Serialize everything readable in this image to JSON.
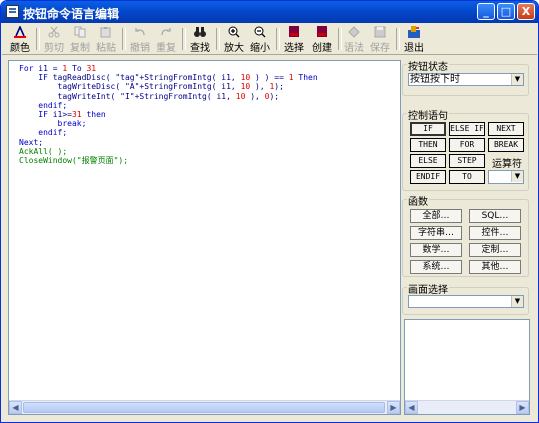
{
  "window": {
    "title": "按钮命令语言编辑",
    "minimize": "_",
    "maximize": "□",
    "close": "X"
  },
  "toolbar": {
    "color": "颜色",
    "cut": "剪切",
    "copy": "复制",
    "paste": "粘贴",
    "undo": "撤销",
    "redo": "重复",
    "find": "查找",
    "zoom_in": "放大",
    "zoom_out": "缩小",
    "select": "选择",
    "create": "创建",
    "syntax": "语法",
    "save": "保存",
    "exit": "退出"
  },
  "editor": {
    "lines": [
      [
        {
          "t": "For ",
          "c": "kw"
        },
        {
          "t": "i1 = ",
          "c": ""
        },
        {
          "t": "1",
          "c": "num"
        },
        {
          "t": " To ",
          "c": "kw"
        },
        {
          "t": "31",
          "c": "num"
        }
      ],
      [
        {
          "t": "    IF ",
          "c": "kw"
        },
        {
          "t": "tagReadDisc( \"tag\"+StringFromIntg( i1, ",
          "c": ""
        },
        {
          "t": "10",
          "c": "num"
        },
        {
          "t": " ) ) == ",
          "c": ""
        },
        {
          "t": "1",
          "c": "num"
        },
        {
          "t": " Then",
          "c": "kw"
        }
      ],
      [
        {
          "t": "        tagWriteDisc( \"A\"+StringFromIntg( i1, ",
          "c": ""
        },
        {
          "t": "10",
          "c": "num"
        },
        {
          "t": " ), ",
          "c": ""
        },
        {
          "t": "1",
          "c": "num"
        },
        {
          "t": ");",
          "c": ""
        }
      ],
      [
        {
          "t": "        tagWriteInt( \"I\"+StringFromIntg( i1, ",
          "c": ""
        },
        {
          "t": "10",
          "c": "num"
        },
        {
          "t": " ), ",
          "c": ""
        },
        {
          "t": "0",
          "c": "num"
        },
        {
          "t": ");",
          "c": ""
        }
      ],
      [
        {
          "t": "    endif;",
          "c": "kw"
        }
      ],
      [
        {
          "t": "    IF ",
          "c": "kw"
        },
        {
          "t": "i1>=",
          "c": ""
        },
        {
          "t": "31",
          "c": "num"
        },
        {
          "t": " then",
          "c": "kw"
        }
      ],
      [
        {
          "t": "        break;",
          "c": "kw"
        }
      ],
      [
        {
          "t": "    endif;",
          "c": "kw"
        }
      ],
      [
        {
          "t": "Next;",
          "c": "kw"
        }
      ],
      [
        {
          "t": "AckAll( );",
          "c": "gr"
        }
      ],
      [
        {
          "t": "CloseWindow(\"报警页面\");",
          "c": "gr"
        }
      ]
    ]
  },
  "panel": {
    "state_group": "按钮状态",
    "state_value": "按钮按下时",
    "control_group": "控制语句",
    "control_buttons": [
      "IF",
      "ELSE IF",
      "NEXT",
      "THEN",
      "FOR",
      "BREAK",
      "ELSE",
      "STEP",
      "ENDIF",
      "TO"
    ],
    "operator_label": "运算符",
    "function_group": "函数",
    "function_buttons": [
      "全部…",
      "SQL…",
      "字符串…",
      "控件…",
      "数学…",
      "定制…",
      "系统…",
      "其他…"
    ],
    "screen_group": "画面选择",
    "screen_value": ""
  }
}
